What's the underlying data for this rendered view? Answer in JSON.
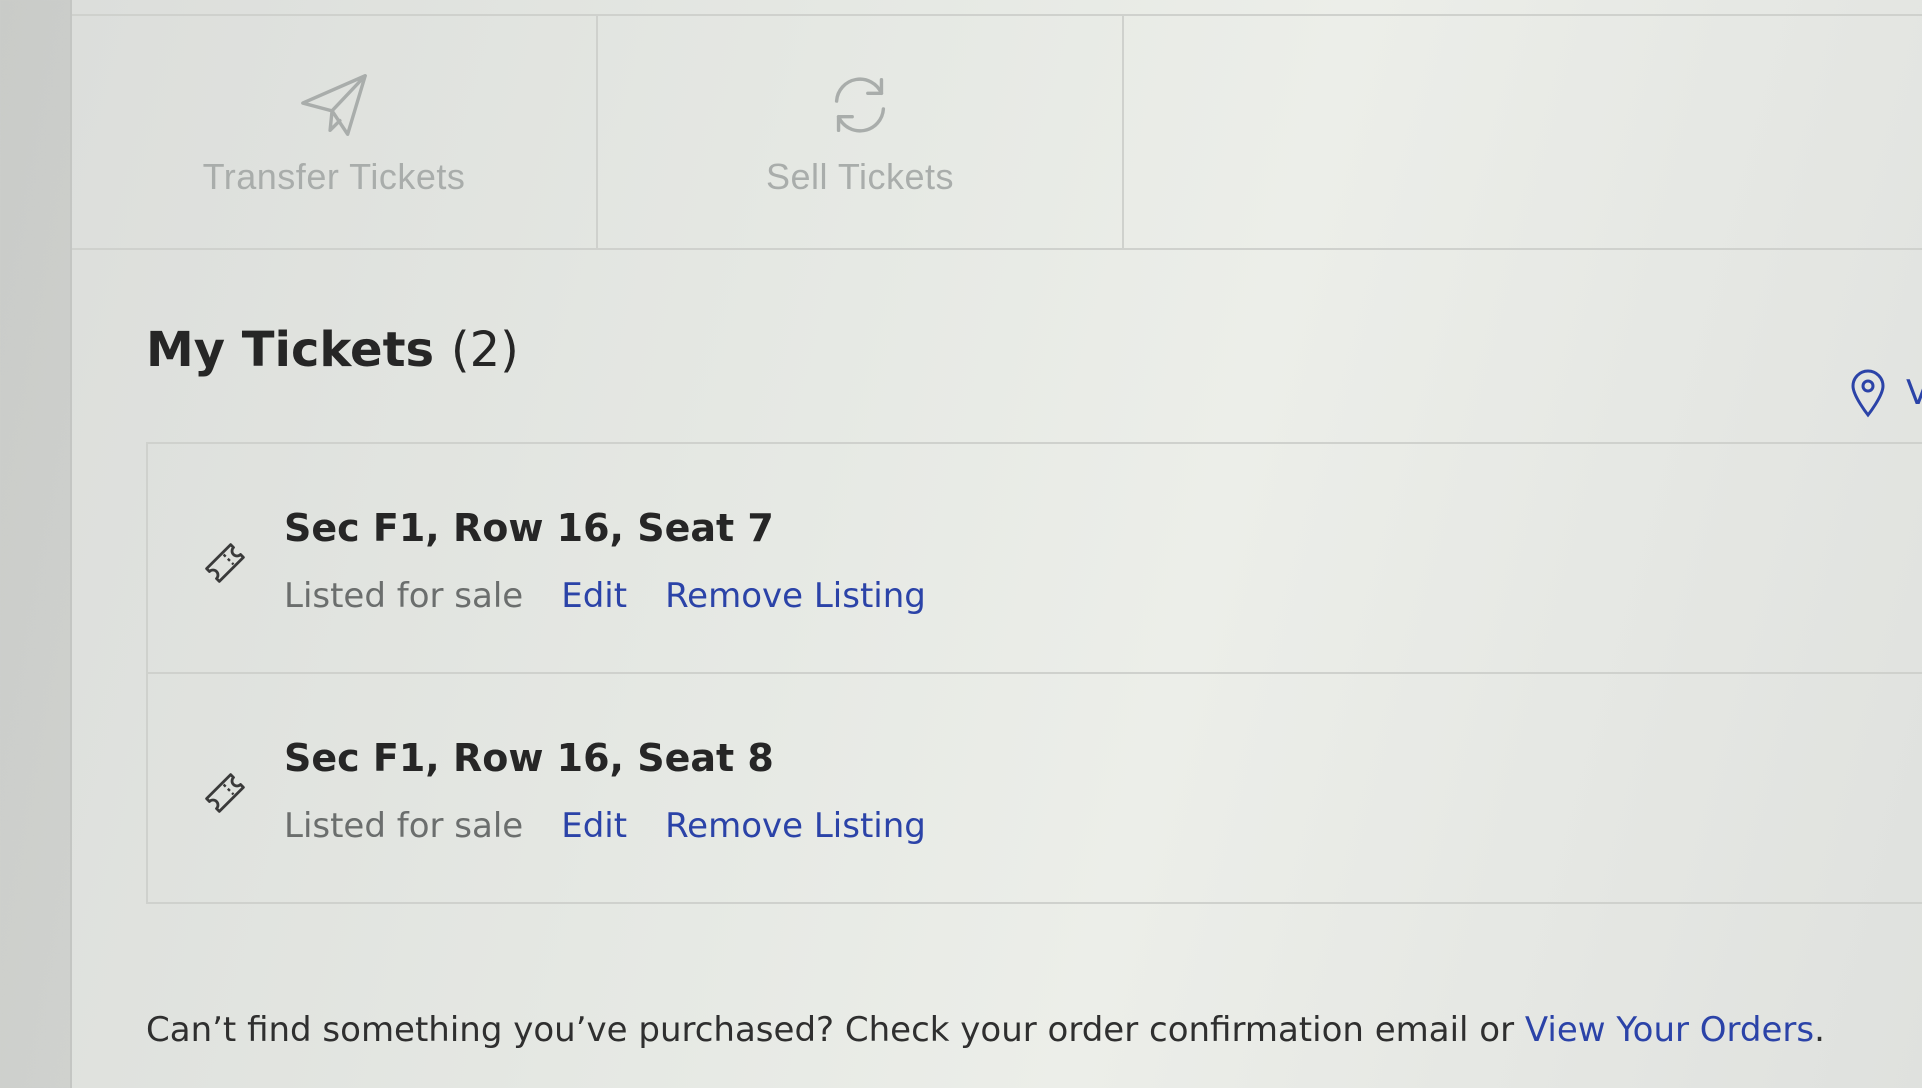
{
  "actions": [
    {
      "label": "Transfer Tickets",
      "icon": "paper-plane-icon"
    },
    {
      "label": "Sell Tickets",
      "icon": "refresh-icon"
    }
  ],
  "my_tickets": {
    "title": "My Tickets",
    "count": "(2)",
    "venue_link": {
      "icon": "map-pin-icon",
      "label": "V"
    },
    "tickets": [
      {
        "seat": "Sec F1, Row 16, Seat 7",
        "status": "Listed for sale",
        "edit_label": "Edit",
        "remove_label": "Remove Listing",
        "icon": "ticket-icon"
      },
      {
        "seat": "Sec F1, Row 16, Seat 8",
        "status": "Listed for sale",
        "edit_label": "Edit",
        "remove_label": "Remove Listing",
        "icon": "ticket-icon"
      }
    ]
  },
  "footer": {
    "text": "Can’t find something you’ve purchased? Check your order confirmation email or ",
    "link_label": "View Your Orders",
    "suffix": "."
  },
  "colors": {
    "link": "#2b43a8",
    "text": "#262626",
    "muted": "#6b6e6d",
    "tile_label": "#a9adab"
  }
}
